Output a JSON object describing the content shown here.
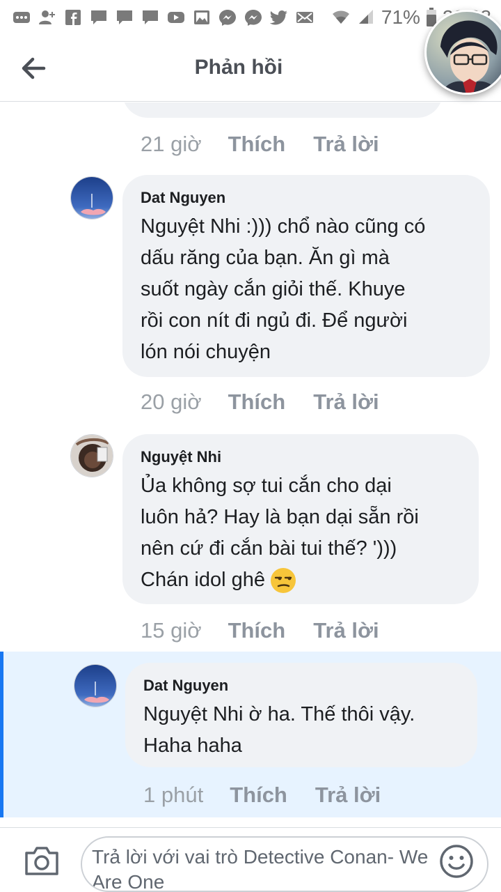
{
  "status_bar": {
    "left_icons": [
      "more-icon",
      "add-friend-icon",
      "facebook-icon",
      "message-icon",
      "message-icon",
      "message-icon",
      "youtube-icon",
      "gallery-icon",
      "messenger-icon",
      "messenger-icon",
      "twitter-icon",
      "email-icon"
    ],
    "battery": "71%",
    "time": "22:08"
  },
  "header": {
    "title": "Phản hồi"
  },
  "thread": {
    "previous_reply": {
      "time": "21 giờ",
      "like": "Thích",
      "reply": "Trả lời"
    },
    "comments": [
      {
        "author": "Dat Nguyen",
        "lines": [
          "Nguyệt Nhi :))) chổ nào cũng có",
          "dấu răng của bạn. Ăn gì mà",
          "suốt ngày cắn giỏi thế. Khuye",
          "rồi con nít đi ngủ đi. Để người",
          "lón nói chuyện"
        ],
        "time": "20 giờ",
        "like": "Thích",
        "reply": "Trả lời"
      },
      {
        "author": "Nguyệt Nhi",
        "lines": [
          "Ủa không sợ tui cắn cho dại",
          "luôn hả? Hay là bạn dại sẵn rồi",
          "nên cứ đi cắn bài tui thế? ')))",
          "Chán idol ghê"
        ],
        "emoji": "unamused-face-emoji",
        "time": "15 giờ",
        "like": "Thích",
        "reply": "Trả lời"
      },
      {
        "author": "Dat Nguyen",
        "lines": [
          "Nguyệt Nhi  ờ ha. Thế thôi vậy.",
          "Haha haha"
        ],
        "time": "1 phút",
        "like": "Thích",
        "reply": "Trả lời",
        "highlighted": true
      }
    ]
  },
  "composer": {
    "placeholder": "Trả lời với vai trò Detective Conan- We Are One"
  },
  "colors": {
    "accent": "#1877f2",
    "highlight_bg": "#e7f3ff",
    "bubble_bg": "#f0f2f5",
    "meta_text": "#8d949e"
  }
}
